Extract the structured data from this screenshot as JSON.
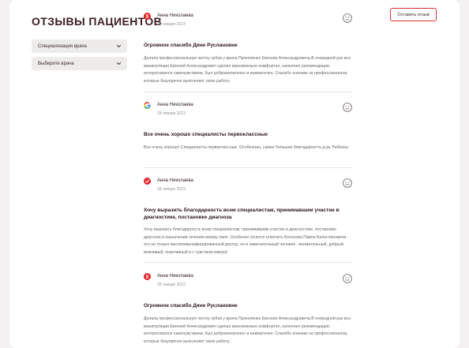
{
  "page": {
    "title": "ОТЗЫВЫ ПАЦИЕНТОВ",
    "filters": [
      {
        "label": "Специализация врача"
      },
      {
        "label": "Выберите врача"
      }
    ],
    "leave_review_label": "Оставить отзыв"
  },
  "reviews": [
    {
      "source": "yandex",
      "author": "Анна Николаева",
      "date": "28 января 2023",
      "title": "Огромное спасибо Дяне Руслановне",
      "text": "Делала профессиональную чистку зубов у врача Прокопенко Евгения Александровича.В очередной раз все манипуляции Евгений Александрович сделал максимально комфортно, наполнил рекомендации, интересовался самочувствием, был доброжелателен и внимателен. Спасибо клинике за профессионалов, которые безупречно выполняют свою работу."
    },
    {
      "source": "google",
      "author": "Анна Николаева",
      "date": "28 января 2023",
      "title": "Все очень хорошо специалисты первоклассные",
      "text": "Все очень хорошо! Специалисты первоклассные. Особенная, самая большая благодарность д-ру Любезну."
    },
    {
      "source": "prodoctorov",
      "author": "Анна Николаева",
      "date": "28 января 2023",
      "title": "Хочу выразить благодарность всем специалистам, принимавшим участие в диагностике, постановке диагноза",
      "text": "Хочу выразить благодарность всем специалистам, принимавшим участие в диагностике, постановке диагноза и назначении лечения моему папе. Особенно хочется отметить Колосова Павла Валентиновича - это не только высококвалифицированный доктор, но и замечательный человек - внимательный, добрый, вежливый, позитивный и с чувством юмора!"
    },
    {
      "source": "yandex",
      "author": "Анна Николаева",
      "date": "28 января 2023",
      "title": "Огромное спасибо Дяне Руслановне",
      "text": "Делала профессиональную чистку зубов у врача Прокопенко Евгения Александровича.В очередной раз все манипуляции Евгений Александрович сделал максимально комфортно, наполнил рекомендации, интересовался самочувствием, был доброжелателен и внимателен. Спасибо клинике за профессионалов, которые безупречно выполняют свою работу."
    }
  ],
  "icons": {
    "yandex": "yandex-logo-icon",
    "google": "google-logo-icon",
    "prodoctorov": "prodoctorov-logo-icon",
    "rating": "smile-face-icon",
    "dropdown": "chevron-down-icon"
  },
  "colors": {
    "accent": "#d9303a",
    "title": "#3b1d21",
    "filter_bg": "#eeeceb"
  }
}
